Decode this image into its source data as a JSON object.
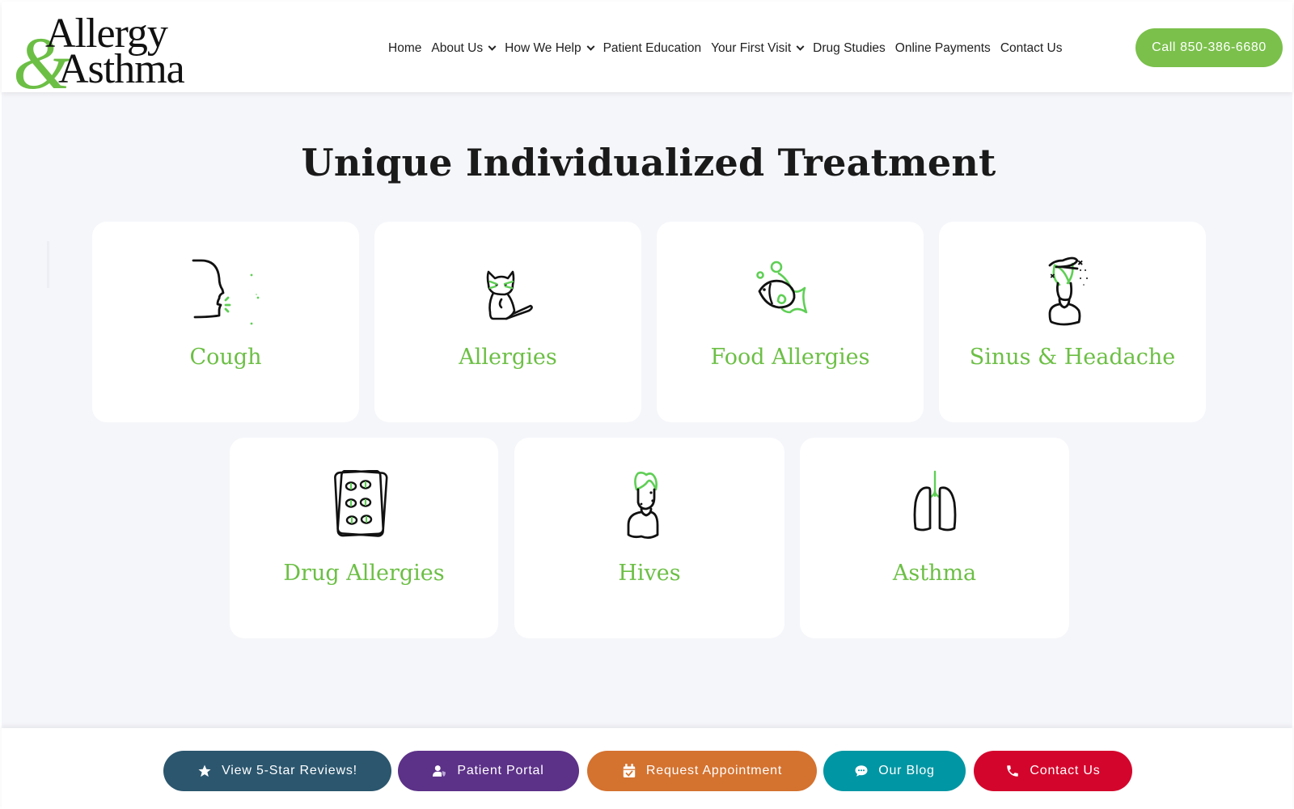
{
  "header": {
    "logo": {
      "line1": "Allergy",
      "ampersand": "&",
      "line2": "Asthma"
    },
    "nav": [
      {
        "label": "Home",
        "dropdown": false
      },
      {
        "label": "About Us",
        "dropdown": true
      },
      {
        "label": "How We Help",
        "dropdown": true
      },
      {
        "label": "Patient Education",
        "dropdown": false
      },
      {
        "label": "Your First Visit",
        "dropdown": true
      },
      {
        "label": "Drug Studies",
        "dropdown": false
      },
      {
        "label": "Online Payments",
        "dropdown": false
      },
      {
        "label": "Contact Us",
        "dropdown": false
      }
    ],
    "call_button": "Call 850-386-6680"
  },
  "main": {
    "title": "Unique Individualized Treatment",
    "cards": [
      {
        "label": "Cough",
        "icon": "cough-face-icon"
      },
      {
        "label": "Allergies",
        "icon": "cat-icon"
      },
      {
        "label": "Food Allergies",
        "icon": "fish-icon"
      },
      {
        "label": "Sinus & Headache",
        "icon": "headache-person-icon"
      },
      {
        "label": "Drug Allergies",
        "icon": "pill-pack-icon"
      },
      {
        "label": "Hives",
        "icon": "hives-person-icon"
      },
      {
        "label": "Asthma",
        "icon": "lungs-icon"
      }
    ]
  },
  "bottom_bar": {
    "buttons": [
      {
        "label": "View 5-Star Reviews!",
        "icon": "star-icon",
        "color": "#2b566e"
      },
      {
        "label": "Patient Portal",
        "icon": "user-shield-icon",
        "color": "#5c3188"
      },
      {
        "label": "Request Appointment",
        "icon": "calendar-check-icon",
        "color": "#d4722f"
      },
      {
        "label": "Our Blog",
        "icon": "chat-bubble-icon",
        "color": "#0096a3"
      },
      {
        "label": "Contact Us",
        "icon": "phone-icon",
        "color": "#d4052c"
      }
    ]
  },
  "colors": {
    "accent_green": "#6cbf45",
    "call_button": "#7ac04b",
    "background": "#f5f6fa"
  }
}
